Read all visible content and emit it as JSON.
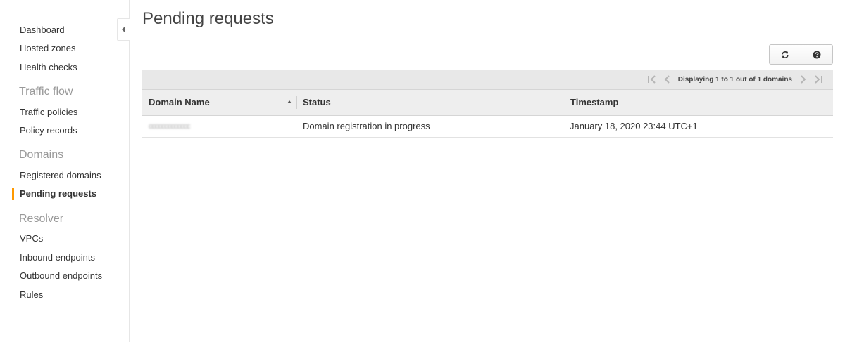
{
  "sidebar": {
    "items": [
      {
        "label": "Dashboard"
      },
      {
        "label": "Hosted zones"
      },
      {
        "label": "Health checks"
      }
    ],
    "sections": [
      {
        "title": "Traffic flow",
        "items": [
          {
            "label": "Traffic policies"
          },
          {
            "label": "Policy records"
          }
        ]
      },
      {
        "title": "Domains",
        "items": [
          {
            "label": "Registered domains"
          },
          {
            "label": "Pending requests"
          }
        ]
      },
      {
        "title": "Resolver",
        "items": [
          {
            "label": "VPCs"
          },
          {
            "label": "Inbound endpoints"
          },
          {
            "label": "Outbound endpoints"
          },
          {
            "label": "Rules"
          }
        ]
      }
    ],
    "active_item": "Pending requests",
    "accent_color": "#ff9900"
  },
  "main": {
    "title": "Pending requests",
    "toolbar": {
      "refresh_icon": "refresh-icon",
      "help_icon": "help-icon"
    },
    "pager": {
      "text": "Displaying 1 to 1 out of 1 domains"
    },
    "columns": [
      {
        "label": "Domain Name",
        "sorted": "ascending"
      },
      {
        "label": "Status"
      },
      {
        "label": "Timestamp"
      }
    ],
    "rows": [
      {
        "domain": "ccccccccccccc",
        "status": "Domain registration in progress",
        "timestamp": "January 18, 2020 23:44 UTC+1"
      }
    ]
  }
}
